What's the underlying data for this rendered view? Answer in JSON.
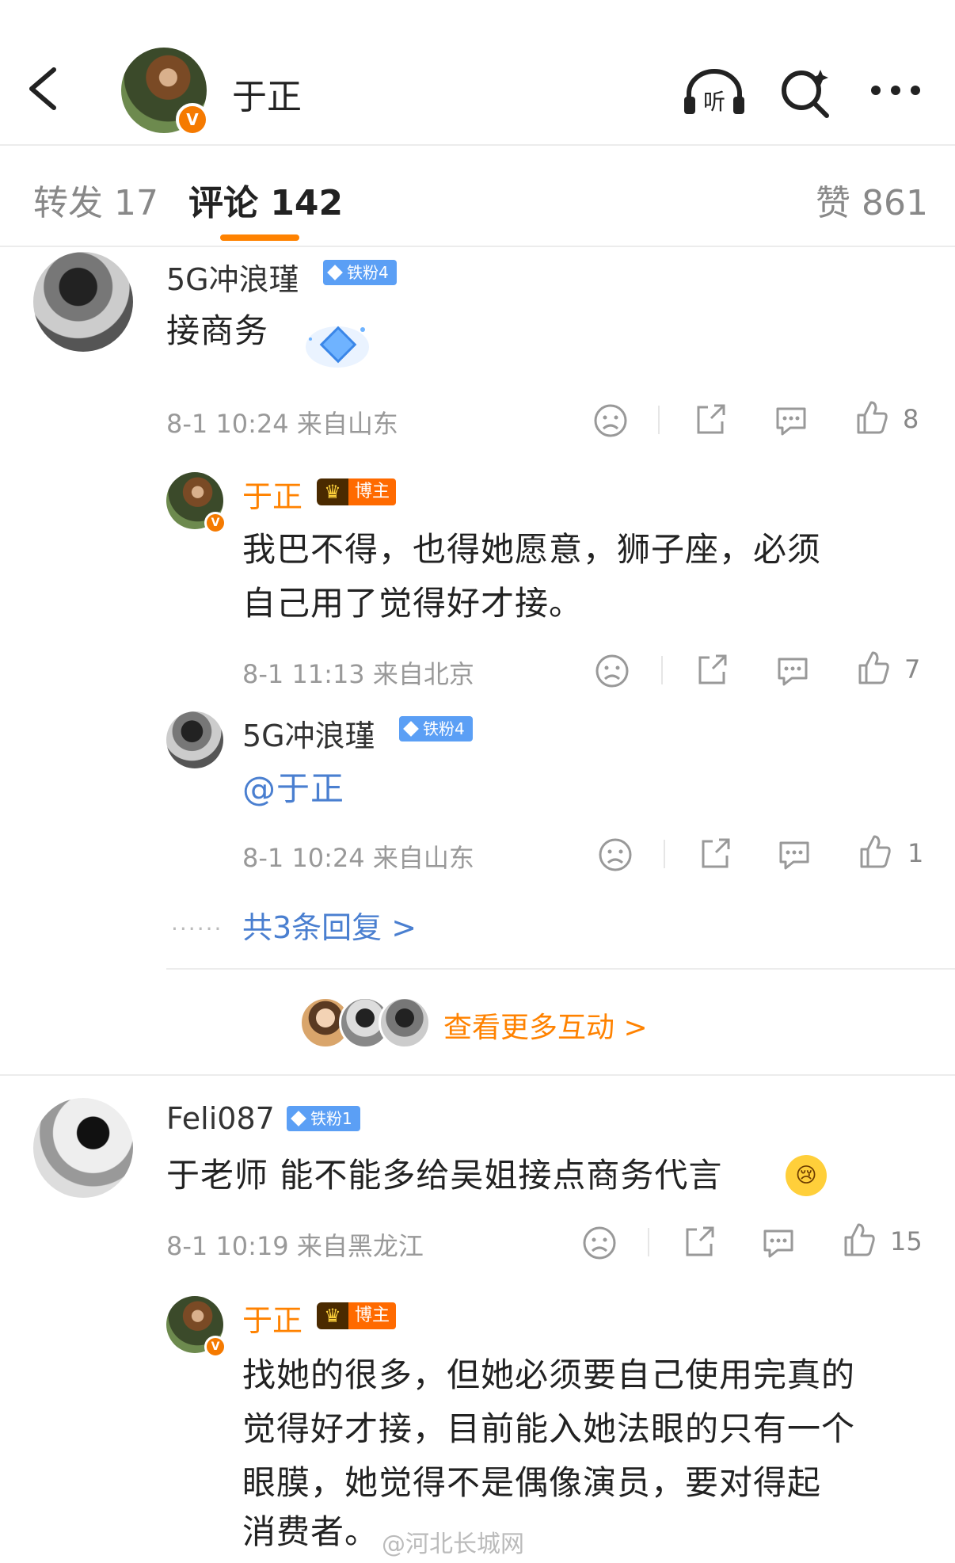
{
  "header": {
    "title": "于正",
    "verified_mark": "V"
  },
  "tabs": [
    {
      "label": "转发 17"
    },
    {
      "label": "评论 142"
    },
    {
      "label": "赞 861"
    }
  ],
  "comments": [
    {
      "user": "5G冲浪瑾",
      "badge": "铁粉4",
      "text": "接商务",
      "meta": "8-1 10:24 来自山东",
      "likes": "8",
      "replies": [
        {
          "user": "于正",
          "badge": "博主",
          "text_line1": "我巴不得，也得她愿意，狮子座，必须",
          "text_line2": "自己用了觉得好才接。",
          "meta": "8-1 11:13 来自北京",
          "likes": "7"
        },
        {
          "user": "5G冲浪瑾",
          "badge": "铁粉4",
          "text": "@于正",
          "meta": "8-1 10:24 来自山东",
          "likes": "1"
        }
      ],
      "reply_link": "共3条回复 >",
      "reply_dots": "......"
    },
    {
      "user": "Feli087",
      "badge": "铁粉1",
      "text": "于老师 能不能多给吴姐接点商务代言",
      "meta": "8-1 10:19 来自黑龙江",
      "likes": "15",
      "replies": [
        {
          "user": "于正",
          "badge": "博主",
          "text_line1": "找她的很多，但她必须要自己使用完真的",
          "text_line2": "觉得好才接，目前能入她法眼的只有一个",
          "text_line3": "眼膜，她觉得不是偶像演员，要对得起",
          "text_line4": "消费者。"
        }
      ]
    }
  ],
  "more_interaction": "查看更多互动 >",
  "watermark": "@河北长城网",
  "colors": {
    "accent": "#ff8200",
    "link": "#4a7fd0",
    "fan_badge": "#5b9ff5"
  }
}
